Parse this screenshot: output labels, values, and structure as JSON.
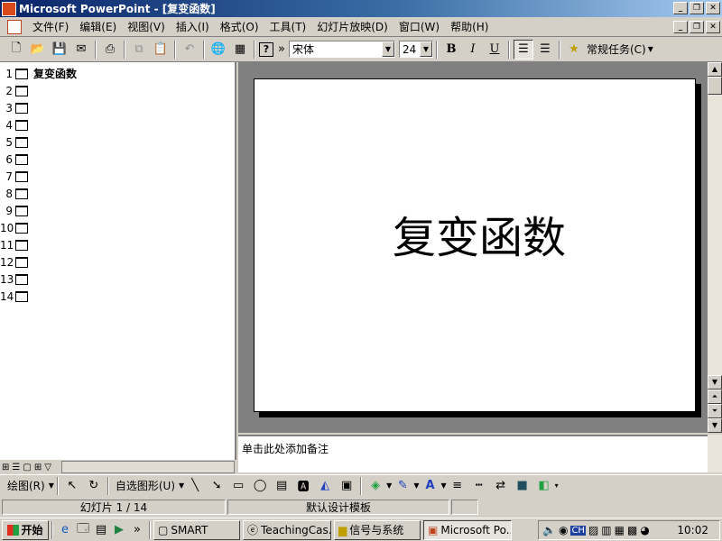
{
  "window": {
    "title": "Microsoft PowerPoint - [复变函数]"
  },
  "menu": [
    "文件(F)",
    "编辑(E)",
    "视图(V)",
    "插入(I)",
    "格式(O)",
    "工具(T)",
    "幻灯片放映(D)",
    "窗口(W)",
    "帮助(H)"
  ],
  "toolbar": {
    "font": "宋体",
    "size": "24",
    "bold": "B",
    "italic": "I",
    "underline": "U",
    "tasks": "常规任务(C)",
    "help": "?",
    "more": "»"
  },
  "outline": {
    "slides": [
      {
        "num": "1",
        "title": "复变函数"
      },
      {
        "num": "2",
        "title": ""
      },
      {
        "num": "3",
        "title": ""
      },
      {
        "num": "4",
        "title": ""
      },
      {
        "num": "5",
        "title": ""
      },
      {
        "num": "6",
        "title": ""
      },
      {
        "num": "7",
        "title": ""
      },
      {
        "num": "8",
        "title": ""
      },
      {
        "num": "9",
        "title": ""
      },
      {
        "num": "10",
        "title": ""
      },
      {
        "num": "11",
        "title": ""
      },
      {
        "num": "12",
        "title": ""
      },
      {
        "num": "13",
        "title": ""
      },
      {
        "num": "14",
        "title": ""
      }
    ]
  },
  "slide": {
    "title": "复变函数"
  },
  "notes": {
    "placeholder": "单击此处添加备注"
  },
  "drawing": {
    "draw": "绘图(R)",
    "autoshapes": "自选图形(U)"
  },
  "status": {
    "slide": "幻灯片 1 / 14",
    "template": "默认设计模板"
  },
  "taskbar": {
    "start": "开始",
    "tasks": [
      "SMART",
      "TeachingCas...",
      "信号与系统",
      "Microsoft Po..."
    ],
    "clock": "10:02",
    "tray_ime": "CH"
  }
}
